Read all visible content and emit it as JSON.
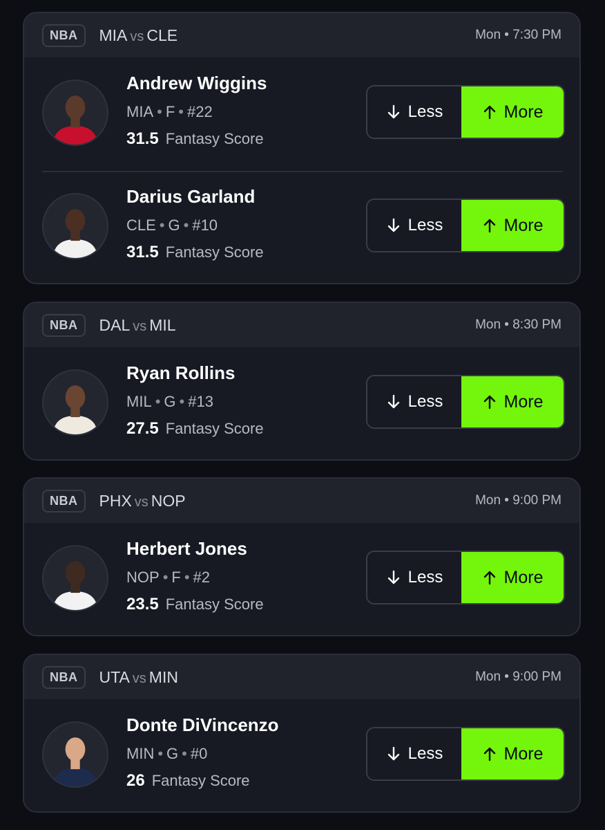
{
  "cards": [
    {
      "league": "NBA",
      "away": "MIA",
      "vs": "vs",
      "home": "CLE",
      "time": "Mon • 7:30 PM",
      "players": [
        {
          "name": "Andrew Wiggins",
          "team": "MIA",
          "position": "F",
          "number": "#22",
          "line": "31.5",
          "stat": "Fantasy Score",
          "jersey_color": "#c8102e",
          "skin": "#5a3a2a"
        },
        {
          "name": "Darius Garland",
          "team": "CLE",
          "position": "G",
          "number": "#10",
          "line": "31.5",
          "stat": "Fantasy Score",
          "jersey_color": "#f1f1f1",
          "skin": "#4a2f22"
        }
      ]
    },
    {
      "league": "NBA",
      "away": "DAL",
      "vs": "vs",
      "home": "MIL",
      "time": "Mon • 8:30 PM",
      "players": [
        {
          "name": "Ryan Rollins",
          "team": "MIL",
          "position": "G",
          "number": "#13",
          "line": "27.5",
          "stat": "Fantasy Score",
          "jersey_color": "#eeeae0",
          "skin": "#6a4532"
        }
      ]
    },
    {
      "league": "NBA",
      "away": "PHX",
      "vs": "vs",
      "home": "NOP",
      "time": "Mon • 9:00 PM",
      "players": [
        {
          "name": "Herbert Jones",
          "team": "NOP",
          "position": "F",
          "number": "#2",
          "line": "23.5",
          "stat": "Fantasy Score",
          "jersey_color": "#f2f2f2",
          "skin": "#3e2a20"
        }
      ]
    },
    {
      "league": "NBA",
      "away": "UTA",
      "vs": "vs",
      "home": "MIN",
      "time": "Mon • 9:00 PM",
      "players": [
        {
          "name": "Donte DiVincenzo",
          "team": "MIN",
          "position": "G",
          "number": "#0",
          "line": "26",
          "stat": "Fantasy Score",
          "jersey_color": "#1d2b4c",
          "skin": "#d8a888"
        }
      ]
    }
  ],
  "buttons": {
    "less_label": "Less",
    "more_label": "More",
    "less_icon": "arrow-down-icon",
    "more_icon": "arrow-up-icon"
  },
  "colors": {
    "more_bg": "#74f50c",
    "card_bg": "#171923",
    "page_bg": "#0d0e14"
  }
}
